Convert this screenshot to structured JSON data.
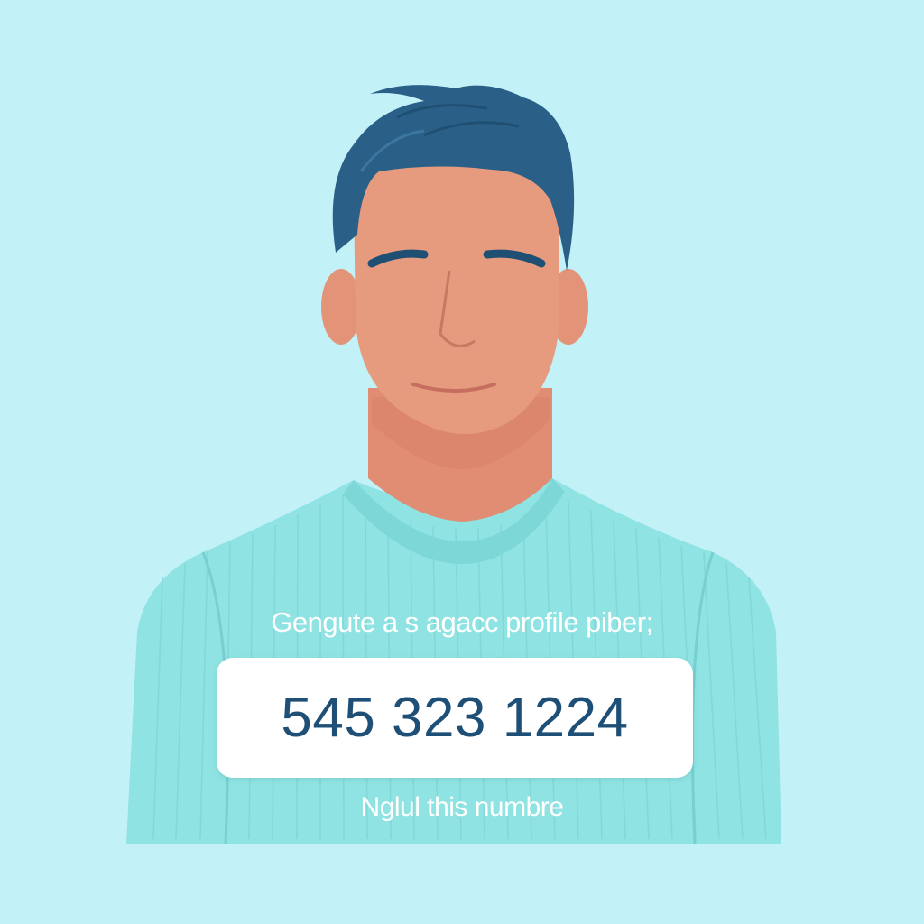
{
  "colors": {
    "background": "#c3f1f8",
    "sweater": "#8fe3e2",
    "skin": "#e79b7e",
    "hair": "#2a6087",
    "number_text": "#1e4f76",
    "caption_text": "#ffffff"
  },
  "texts": {
    "caption_top": "Gengute a s agacc profile piber;",
    "phone_number": "545 323 1224",
    "caption_bottom": "Nglul this numbre"
  }
}
